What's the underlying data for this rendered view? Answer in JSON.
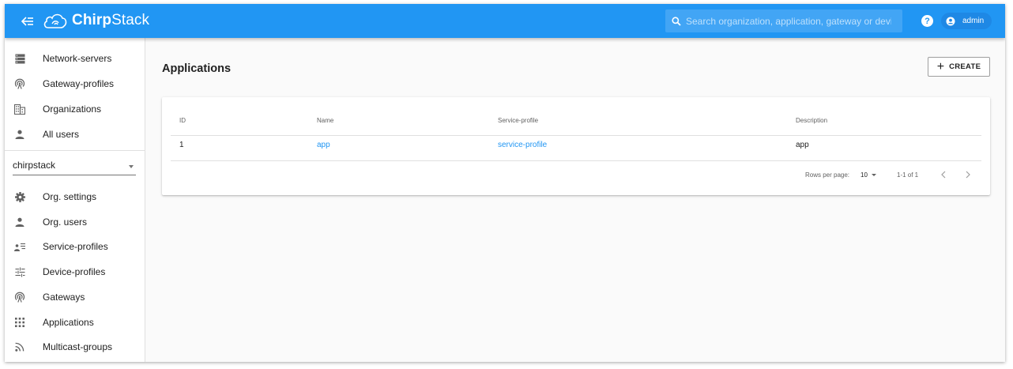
{
  "app": {
    "name_strong": "Chirp",
    "name_light": "Stack",
    "brand_color": "#2196f3"
  },
  "header": {
    "menu_icon": "menu-collapse-icon",
    "search_placeholder": "Search organization, application, gateway or device",
    "help_icon": "help-circle-icon",
    "help_glyph": "?",
    "user_label": "admin"
  },
  "sidebar": {
    "global_items": [
      {
        "label": "Network-servers",
        "icon": "server-icon"
      },
      {
        "label": "Gateway-profiles",
        "icon": "antenna-icon"
      },
      {
        "label": "Organizations",
        "icon": "building-icon"
      },
      {
        "label": "All users",
        "icon": "person-icon"
      }
    ],
    "organization_select": "chirpstack",
    "org_items": [
      {
        "label": "Org. settings",
        "icon": "gear-icon"
      },
      {
        "label": "Org. users",
        "icon": "person-icon"
      },
      {
        "label": "Service-profiles",
        "icon": "account-details-icon"
      },
      {
        "label": "Device-profiles",
        "icon": "tune-icon"
      },
      {
        "label": "Gateways",
        "icon": "antenna-icon"
      },
      {
        "label": "Applications",
        "icon": "apps-grid-icon"
      },
      {
        "label": "Multicast-groups",
        "icon": "rss-icon"
      }
    ]
  },
  "main": {
    "title": "Applications",
    "create_label": "CREATE",
    "table": {
      "headers": [
        "ID",
        "Name",
        "Service-profile",
        "Description"
      ],
      "rows": [
        {
          "id": "1",
          "name": "app",
          "service_profile": "service-profile",
          "description": "app"
        }
      ]
    },
    "pagination": {
      "rows_per_page_label": "Rows per page:",
      "rows_per_page": "10",
      "range": "1-1 of 1"
    }
  }
}
